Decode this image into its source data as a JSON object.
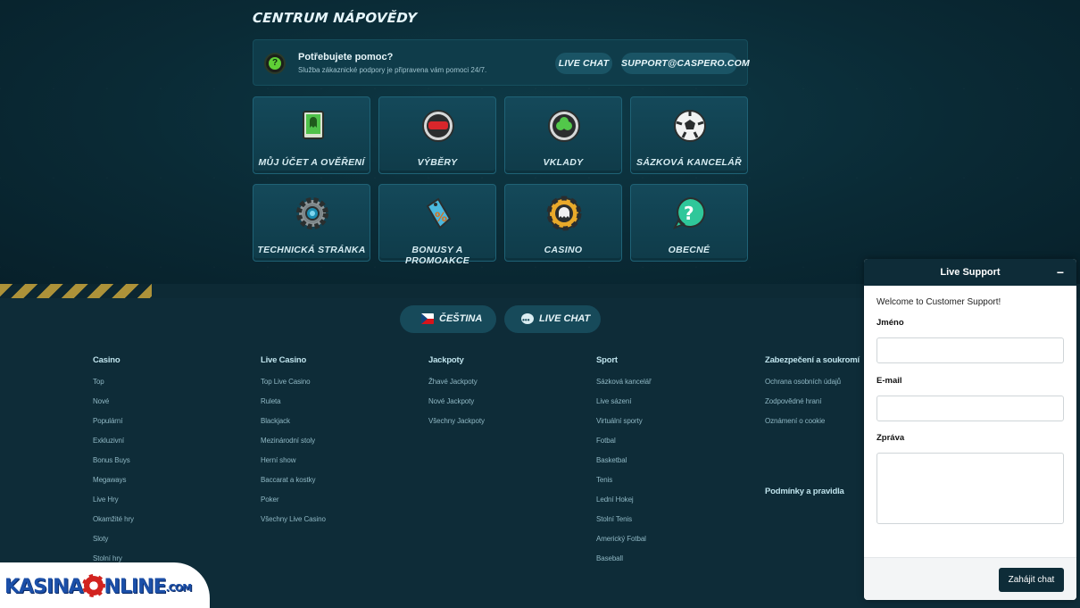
{
  "help": {
    "title": "CENTRUM NÁPOVĚDY",
    "heading": "Potřebujete pomoc?",
    "subtext": "Služba zákaznické podpory je připravena vám pomoci 24/7.",
    "live_chat": "LIVE CHAT",
    "email": "SUPPORT@CASPERO.COM"
  },
  "tiles": [
    {
      "label": "MŮJ ÚČET A OVĚŘENÍ",
      "icon": "account-card-icon"
    },
    {
      "label": "VÝBĚRY",
      "icon": "withdrawal-icon"
    },
    {
      "label": "VKLADY",
      "icon": "deposit-icon"
    },
    {
      "label": "SÁZKOVÁ KANCELÁŘ",
      "icon": "football-icon"
    },
    {
      "label": "TECHNICKÁ STRÁNKA",
      "icon": "gear-icon"
    },
    {
      "label": "BONUSY A PROMOAKCE",
      "icon": "percent-tag-icon"
    },
    {
      "label": "CASINO",
      "icon": "casino-chip-icon"
    },
    {
      "label": "OBECNÉ",
      "icon": "question-icon"
    }
  ],
  "footer": {
    "language": "ČEŠTINA",
    "live_chat": "LIVE CHAT",
    "columns": [
      {
        "title": "Casino",
        "items": [
          "Top",
          "Nové",
          "Populární",
          "Exkluzivní",
          "Bonus Buys",
          "Megaways",
          "Live Hry",
          "Okamžité hry",
          "Sloty",
          "Stolní hry"
        ]
      },
      {
        "title": "Live Casino",
        "items": [
          "Top Live Casino",
          "Ruleta",
          "Blackjack",
          "Mezinárodní stoly",
          "Herní show",
          "Baccarat a kostky",
          "Poker",
          "Všechny Live Casino"
        ]
      },
      {
        "title": "Jackpoty",
        "items": [
          "Žhavé Jackpoty",
          "Nové Jackpoty",
          "Všechny Jackpoty"
        ]
      },
      {
        "title": "Sport",
        "items": [
          "Sázková kancelář",
          "Live sázení",
          "Virtuální sporty",
          "Fotbal",
          "Basketbal",
          "Tenis",
          "Lední Hokej",
          "Stolní Tenis",
          "Americký Fotbal",
          "Baseball"
        ]
      },
      {
        "title": "Zabezpečení a soukromí",
        "items": [
          "Ochrana osobních údajů",
          "Zodpovědné hraní",
          "Oznámení o cookie"
        ]
      }
    ],
    "terms_title": "Podmínky a pravidla"
  },
  "logo": {
    "part1": "KASINA",
    "part2": "NLINE",
    "part3": ".COM"
  },
  "widget": {
    "title": "Live Support",
    "minimize": "−",
    "welcome": "Welcome to Customer Support!",
    "name_label": "Jméno",
    "email_label": "E-mail",
    "message_label": "Zpráva",
    "submit": "Zahájit chat"
  }
}
